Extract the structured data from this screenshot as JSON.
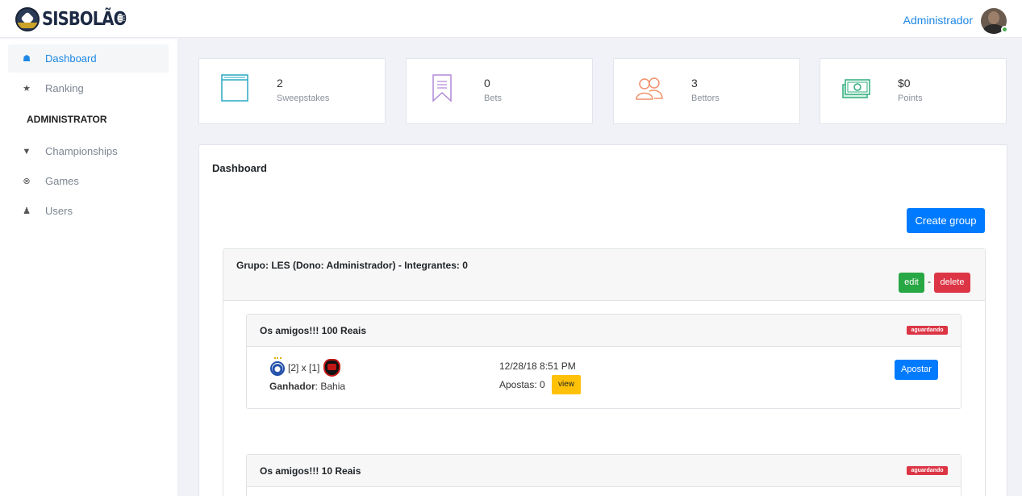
{
  "header": {
    "logo_text": "SISBOLÃO",
    "user_name": "Administrador"
  },
  "sidebar": {
    "items": [
      {
        "label": "Dashboard",
        "icon": "home-icon",
        "active": true
      },
      {
        "label": "Ranking",
        "icon": "star-icon"
      }
    ],
    "section_label": "ADMINISTRATOR",
    "admin_items": [
      {
        "label": "Championships",
        "icon": "trophy-icon"
      },
      {
        "label": "Games",
        "icon": "soccer-ball-icon"
      },
      {
        "label": "Users",
        "icon": "user-icon"
      }
    ]
  },
  "stats": [
    {
      "value": "2",
      "label": "Sweepstakes",
      "icon": "window-icon",
      "color": "#2aa8c4"
    },
    {
      "value": "0",
      "label": "Bets",
      "icon": "bookmark-icon",
      "color": "#b08ad8"
    },
    {
      "value": "3",
      "label": "Bettors",
      "icon": "users-icon",
      "color": "#f0916b"
    },
    {
      "value": "$0",
      "label": "Points",
      "icon": "money-icon",
      "color": "#2fae7c"
    }
  ],
  "main": {
    "title": "Dashboard",
    "create_group_label": "Create group",
    "group": {
      "title": "Grupo: LES (Dono: Administrador) - Integrantes: 0",
      "edit_label": "edit",
      "separator": "-",
      "delete_label": "delete",
      "boloes": [
        {
          "title": "Os amigos!!! 100 Reais",
          "status": "aguardando",
          "game": {
            "score": "[2] x [1]",
            "winner_label": "Ganhador",
            "winner": ": Bahia",
            "date": "12/28/18 8:51 PM",
            "bets_text": "Apostas: 0",
            "view_label": "view",
            "bet_label": "Apostar"
          }
        },
        {
          "title": "Os amigos!!! 10 Reais",
          "status": "aguardando"
        }
      ]
    }
  }
}
